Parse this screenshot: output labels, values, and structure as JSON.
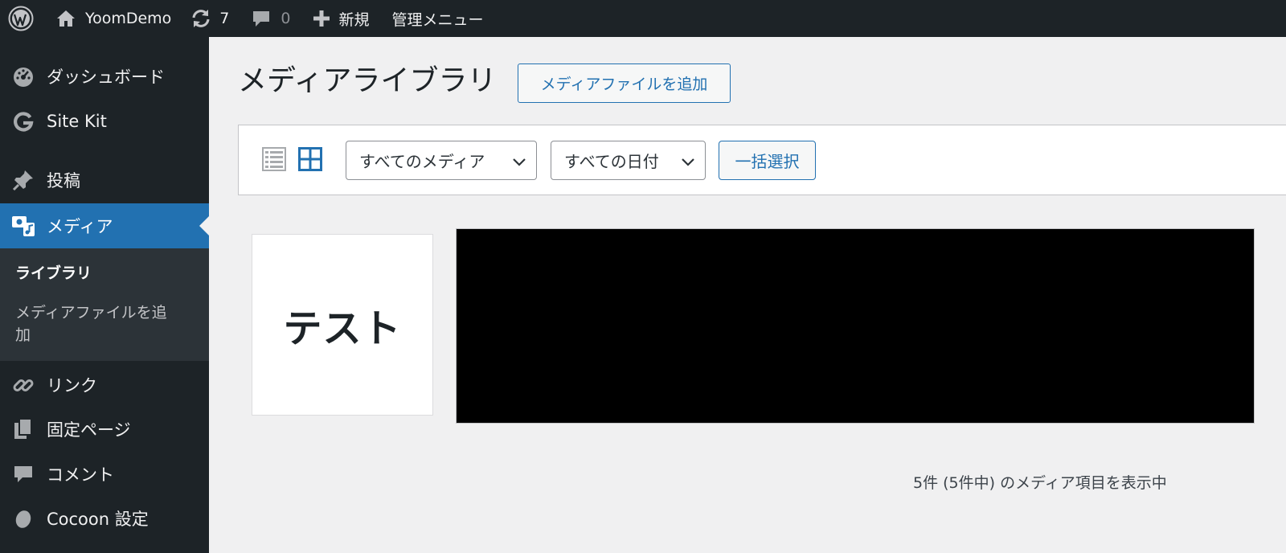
{
  "adminbar": {
    "site_name": "YoomDemo",
    "updates_count": "7",
    "comments_count": "0",
    "new_label": "新規",
    "admin_menu_label": "管理メニュー"
  },
  "sidebar": {
    "items": [
      {
        "label": "ダッシュボード",
        "icon": "dashboard-icon"
      },
      {
        "label": "Site Kit",
        "icon": "google-g-icon"
      },
      {
        "label": "投稿",
        "icon": "pin-icon"
      },
      {
        "label": "メディア",
        "icon": "media-icon",
        "current": true
      },
      {
        "label": "リンク",
        "icon": "link-icon"
      },
      {
        "label": "固定ページ",
        "icon": "page-icon"
      },
      {
        "label": "コメント",
        "icon": "comment-icon"
      },
      {
        "label": "Cocoon 設定",
        "icon": "cocoon-icon"
      }
    ],
    "submenu": [
      {
        "label": "ライブラリ",
        "current": true
      },
      {
        "label_line1": "メディアファイルを追",
        "label_line2": "加"
      }
    ]
  },
  "main": {
    "title": "メディアライブラリ",
    "add_button": "メディアファイルを追加",
    "toolbar": {
      "media_filter": "すべてのメディア",
      "date_filter": "すべての日付",
      "bulk_select": "一括選択"
    },
    "items": [
      {
        "type": "image",
        "text": "テスト"
      },
      {
        "type": "image",
        "fill": "#000000"
      }
    ],
    "count_text": "5件 (5件中) のメディア項目を表示中"
  },
  "colors": {
    "adminbar": "#1d2327",
    "accent": "#2271b1",
    "background": "#f0f0f1"
  }
}
